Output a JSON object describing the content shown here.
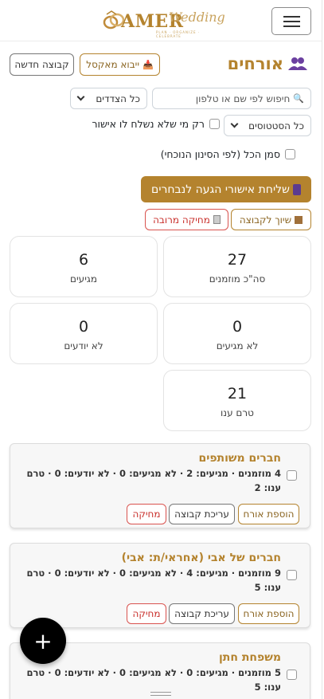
{
  "header": {
    "brand": "AMER",
    "brand_script": "Wedding",
    "tagline": "PLAN · ORGANIZE · CELEBRATE"
  },
  "page": {
    "title": "אורחים",
    "import_excel_label": "ייבוא מאקסל",
    "new_group_label": "קבוצה חדשה"
  },
  "filters": {
    "search_placeholder": "חיפוש לפי שם או טלפון",
    "sides_selected": "כל הצדדים",
    "status_selected": "כל הסטטוסים",
    "unsent_only_label": "רק מי שלא נשלח לו אישור",
    "select_all_label": "סמן הכל (לפי הסינון הנוכחי)"
  },
  "actions": {
    "send_confirmation_label": "שליחת אישורי הגעה לנבחרים",
    "assign_group_label": "שיוך לקבוצה",
    "bulk_delete_label": "מחיקה מרובה"
  },
  "stats": [
    {
      "value": "27",
      "label": "סה\"כ מוזמנים"
    },
    {
      "value": "6",
      "label": "מגיעים"
    },
    {
      "value": "0",
      "label": "לא מגיעים"
    },
    {
      "value": "0",
      "label": "לא יודעים"
    },
    {
      "value": "21",
      "label": "טרם ענו"
    }
  ],
  "group_buttons": {
    "add_guest": "הוספת אורח",
    "edit_group": "עריכת קבוצה",
    "delete": "מחיקה"
  },
  "groups": [
    {
      "name": "חברים משותפים",
      "stats": "4 מוזמנים · מגיעים: 2 · לא מגיעים: 0 · לא יודעים: 0 · טרם ענו: 2"
    },
    {
      "name": "חברים של אבי (אחראי/ת: אבי)",
      "stats": "9 מוזמנים · מגיעים: 4 · לא מגיעים: 0 · לא יודעים: 0 · טרם ענו: 5"
    },
    {
      "name": "משפחת חתן",
      "stats": "5 מוזמנים · מגיעים: 0 · לא מגיעים: 0 · לא יודעים: 0 · טרם ענו: 5"
    }
  ],
  "fab_label": "+",
  "colors": {
    "accent": "#b4832e",
    "danger": "#d9534f"
  }
}
